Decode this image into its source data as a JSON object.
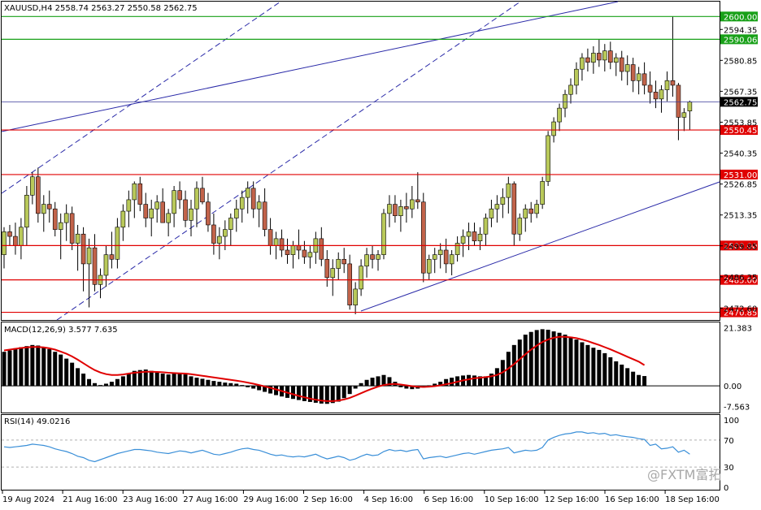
{
  "symbol_header": "XAUUSD,H4  2558.74 2563.27 2550.58 2562.75",
  "colors": {
    "bull_body": "#b9c95a",
    "bear_body": "#c2634a",
    "wick": "#000000",
    "support_line": "#e00000",
    "green_line": "#18a018",
    "channel_line": "#2a2aa8",
    "current_price_line": "#3a3a9a",
    "macd_hist": "#000000",
    "macd_signal": "#e00000",
    "rsi_line": "#3a8fd8",
    "rsi_level": "#b0b0b0",
    "tag_red": "#e00000",
    "tag_green": "#18a018",
    "tag_black": "#000000"
  },
  "price_axis": {
    "ticks": [
      "2594.35",
      "2580.85",
      "2567.35",
      "2553.85",
      "2540.35",
      "2526.85",
      "2513.35",
      "2499.85",
      "2486.35",
      "2472.60"
    ]
  },
  "horizontal_levels": [
    {
      "label": "2600.00",
      "value": 2600.0,
      "kind": "green"
    },
    {
      "label": "2590.06",
      "value": 2590.06,
      "kind": "green"
    },
    {
      "label": "2550.45",
      "value": 2550.45,
      "kind": "red"
    },
    {
      "label": "2531.00",
      "value": 2531.0,
      "kind": "red"
    },
    {
      "label": "2500.00",
      "value": 2500.0,
      "kind": "red"
    },
    {
      "label": "2485.00",
      "value": 2485.0,
      "kind": "red"
    },
    {
      "label": "2470.85",
      "value": 2470.85,
      "kind": "red"
    }
  ],
  "current_price": {
    "label": "2562.75",
    "value": 2562.75
  },
  "time_axis": {
    "labels": [
      "19 Aug 2024",
      "21 Aug 16:00",
      "23 Aug 16:00",
      "27 Aug 16:00",
      "29 Aug 16:00",
      "2 Sep 16:00",
      "4 Sep 16:00",
      "6 Sep 16:00",
      "10 Sep 16:00",
      "12 Sep 16:00",
      "16 Sep 16:00",
      "18 Sep 16:00"
    ]
  },
  "macd": {
    "header": "MACD(12,26,9) 3.577 7.635",
    "axis_ticks": [
      "21.383",
      "0.00",
      "-7.563"
    ]
  },
  "rsi": {
    "header": "RSI(14) 49.0216",
    "axis_ticks": [
      "100",
      "70",
      "30",
      "0"
    ],
    "levels": [
      70,
      30
    ]
  },
  "watermark": "@FXTM富拓",
  "chart_data": {
    "type": "candlestick",
    "series": [
      {
        "name": "XAUUSD,H4"
      }
    ],
    "ohlc_last": {
      "open": 2558.74,
      "high": 2563.27,
      "low": 2550.58,
      "close": 2562.75
    },
    "y_range": [
      2467.5,
      2606.5
    ],
    "candles": [
      [
        2496,
        2508,
        2490,
        2506
      ],
      [
        2506,
        2509,
        2500,
        2504
      ],
      [
        2504,
        2510,
        2496,
        2500
      ],
      [
        2500,
        2512,
        2494,
        2508
      ],
      [
        2508,
        2526,
        2500,
        2522
      ],
      [
        2522,
        2532,
        2518,
        2530
      ],
      [
        2530,
        2534,
        2510,
        2514
      ],
      [
        2514,
        2522,
        2506,
        2518
      ],
      [
        2518,
        2524,
        2510,
        2516
      ],
      [
        2516,
        2519,
        2504,
        2507
      ],
      [
        2507,
        2514,
        2494,
        2510
      ],
      [
        2510,
        2518,
        2502,
        2514
      ],
      [
        2514,
        2517,
        2498,
        2501
      ],
      [
        2501,
        2509,
        2489,
        2505
      ],
      [
        2505,
        2508,
        2480,
        2492
      ],
      [
        2492,
        2503,
        2473,
        2499
      ],
      [
        2499,
        2505,
        2480,
        2483
      ],
      [
        2483,
        2490,
        2477,
        2487
      ],
      [
        2487,
        2500,
        2482,
        2496
      ],
      [
        2496,
        2506,
        2490,
        2494
      ],
      [
        2494,
        2512,
        2490,
        2508
      ],
      [
        2508,
        2518,
        2502,
        2515
      ],
      [
        2515,
        2524,
        2508,
        2520
      ],
      [
        2520,
        2528,
        2512,
        2527
      ],
      [
        2527,
        2530,
        2515,
        2518
      ],
      [
        2518,
        2523,
        2508,
        2512
      ],
      [
        2512,
        2520,
        2504,
        2516
      ],
      [
        2516,
        2522,
        2510,
        2519
      ],
      [
        2519,
        2525,
        2512,
        2510
      ],
      [
        2510,
        2516,
        2504,
        2514
      ],
      [
        2514,
        2526,
        2508,
        2524
      ],
      [
        2524,
        2528,
        2516,
        2520
      ],
      [
        2520,
        2524,
        2508,
        2511
      ],
      [
        2511,
        2520,
        2504,
        2516
      ],
      [
        2516,
        2528,
        2508,
        2525
      ],
      [
        2525,
        2530,
        2518,
        2519
      ],
      [
        2519,
        2523,
        2506,
        2509
      ],
      [
        2509,
        2514,
        2496,
        2501
      ],
      [
        2501,
        2508,
        2494,
        2504
      ],
      [
        2504,
        2511,
        2498,
        2507
      ],
      [
        2507,
        2514,
        2500,
        2512
      ],
      [
        2512,
        2520,
        2506,
        2516
      ],
      [
        2516,
        2524,
        2510,
        2521
      ],
      [
        2521,
        2528,
        2514,
        2525
      ],
      [
        2525,
        2528,
        2512,
        2516
      ],
      [
        2516,
        2522,
        2508,
        2519
      ],
      [
        2519,
        2525,
        2504,
        2507
      ],
      [
        2507,
        2512,
        2496,
        2500
      ],
      [
        2500,
        2506,
        2494,
        2503
      ],
      [
        2503,
        2507,
        2495,
        2498
      ],
      [
        2498,
        2503,
        2492,
        2496
      ],
      [
        2496,
        2502,
        2490,
        2500
      ],
      [
        2500,
        2507,
        2494,
        2498
      ],
      [
        2498,
        2502,
        2492,
        2495
      ],
      [
        2495,
        2500,
        2490,
        2497
      ],
      [
        2497,
        2506,
        2492,
        2503
      ],
      [
        2503,
        2508,
        2491,
        2494
      ],
      [
        2494,
        2498,
        2482,
        2486
      ],
      [
        2486,
        2494,
        2478,
        2490
      ],
      [
        2490,
        2497,
        2485,
        2494
      ],
      [
        2494,
        2499,
        2488,
        2492
      ],
      [
        2492,
        2496,
        2472,
        2474
      ],
      [
        2474,
        2484,
        2470,
        2481
      ],
      [
        2481,
        2494,
        2478,
        2491
      ],
      [
        2491,
        2499,
        2486,
        2496
      ],
      [
        2496,
        2500,
        2490,
        2494
      ],
      [
        2494,
        2498,
        2489,
        2496
      ],
      [
        2496,
        2516,
        2494,
        2514
      ],
      [
        2514,
        2522,
        2508,
        2518
      ],
      [
        2518,
        2522,
        2510,
        2513
      ],
      [
        2513,
        2520,
        2506,
        2517
      ],
      [
        2517,
        2523,
        2510,
        2516
      ],
      [
        2516,
        2526,
        2512,
        2520
      ],
      [
        2520,
        2532,
        2516,
        2519
      ],
      [
        2519,
        2523,
        2484,
        2488
      ],
      [
        2488,
        2496,
        2485,
        2494
      ],
      [
        2494,
        2499,
        2488,
        2496
      ],
      [
        2496,
        2501,
        2490,
        2498
      ],
      [
        2498,
        2503,
        2488,
        2492
      ],
      [
        2492,
        2498,
        2487,
        2496
      ],
      [
        2496,
        2504,
        2493,
        2501
      ],
      [
        2501,
        2507,
        2495,
        2504
      ],
      [
        2504,
        2510,
        2498,
        2506
      ],
      [
        2506,
        2510,
        2500,
        2502
      ],
      [
        2502,
        2508,
        2498,
        2505
      ],
      [
        2505,
        2514,
        2500,
        2512
      ],
      [
        2512,
        2520,
        2508,
        2516
      ],
      [
        2516,
        2522,
        2510,
        2518
      ],
      [
        2518,
        2525,
        2512,
        2521
      ],
      [
        2521,
        2530,
        2514,
        2527
      ],
      [
        2527,
        2528,
        2500,
        2505
      ],
      [
        2505,
        2514,
        2502,
        2512
      ],
      [
        2512,
        2518,
        2506,
        2516
      ],
      [
        2516,
        2519,
        2510,
        2514
      ],
      [
        2514,
        2520,
        2512,
        2518
      ],
      [
        2518,
        2530,
        2516,
        2528
      ],
      [
        2528,
        2550,
        2526,
        2548
      ],
      [
        2548,
        2556,
        2545,
        2554
      ],
      [
        2554,
        2562,
        2550,
        2560
      ],
      [
        2560,
        2568,
        2556,
        2566
      ],
      [
        2566,
        2573,
        2562,
        2570
      ],
      [
        2570,
        2580,
        2566,
        2577
      ],
      [
        2577,
        2584,
        2572,
        2582
      ],
      [
        2582,
        2586,
        2576,
        2580
      ],
      [
        2580,
        2587,
        2575,
        2584
      ],
      [
        2584,
        2590,
        2578,
        2581
      ],
      [
        2581,
        2588,
        2576,
        2585
      ],
      [
        2585,
        2589,
        2577,
        2580
      ],
      [
        2580,
        2584,
        2574,
        2582
      ],
      [
        2582,
        2585,
        2572,
        2576
      ],
      [
        2576,
        2583,
        2570,
        2579
      ],
      [
        2579,
        2582,
        2567,
        2572
      ],
      [
        2572,
        2578,
        2566,
        2575
      ],
      [
        2575,
        2580,
        2566,
        2570
      ],
      [
        2570,
        2576,
        2562,
        2567
      ],
      [
        2567,
        2572,
        2560,
        2564
      ],
      [
        2564,
        2570,
        2558,
        2568
      ],
      [
        2568,
        2576,
        2563,
        2572
      ],
      [
        2572,
        2600,
        2565,
        2570
      ],
      [
        2570,
        2571,
        2546,
        2556
      ],
      [
        2556,
        2560,
        2550,
        2558
      ],
      [
        2558.74,
        2563.27,
        2550.58,
        2562.75
      ]
    ],
    "macd_histogram": [
      12.5,
      13.0,
      13.8,
      14.2,
      14.6,
      15.0,
      14.8,
      14.2,
      13.5,
      12.5,
      11.5,
      10.0,
      8.5,
      6.5,
      4.5,
      2.5,
      1.0,
      0.3,
      0.8,
      1.5,
      2.5,
      3.5,
      4.5,
      5.5,
      5.8,
      6.0,
      5.5,
      5.0,
      4.5,
      4.2,
      4.5,
      4.8,
      4.2,
      3.5,
      3.0,
      2.6,
      2.2,
      1.8,
      1.5,
      1.2,
      1.0,
      0.8,
      0.3,
      -0.5,
      -1.0,
      -1.6,
      -2.2,
      -2.8,
      -3.4,
      -3.9,
      -4.4,
      -4.8,
      -5.2,
      -5.6,
      -5.9,
      -6.2,
      -6.5,
      -6.6,
      -6.3,
      -5.8,
      -4.5,
      -3.0,
      -1.0,
      1.0,
      2.2,
      3.0,
      3.5,
      4.0,
      3.2,
      1.5,
      -0.5,
      -1.0,
      -1.2,
      -1.0,
      -0.6,
      0.2,
      0.8,
      1.5,
      2.5,
      3.0,
      3.5,
      3.8,
      4.0,
      3.8,
      3.5,
      3.5,
      4.5,
      6.5,
      9.5,
      12.5,
      15.0,
      17.0,
      18.8,
      19.8,
      20.5,
      20.8,
      20.6,
      20.0,
      19.5,
      18.8,
      18.0,
      17.0,
      16.0,
      15.0,
      14.0,
      13.2,
      12.0,
      10.5,
      9.0,
      7.8,
      6.5,
      5.2,
      4.0,
      3.6
    ],
    "macd_signal": [
      13.0,
      13.3,
      13.6,
      13.9,
      14.1,
      14.3,
      14.3,
      14.1,
      13.8,
      13.3,
      12.6,
      11.8,
      10.8,
      9.6,
      8.3,
      7.0,
      5.8,
      4.9,
      4.3,
      4.0,
      4.0,
      4.2,
      4.5,
      4.8,
      5.0,
      5.2,
      5.2,
      5.1,
      5.0,
      4.8,
      4.7,
      4.6,
      4.5,
      4.3,
      4.0,
      3.7,
      3.4,
      3.1,
      2.8,
      2.5,
      2.2,
      1.9,
      1.6,
      1.2,
      0.8,
      0.3,
      -0.2,
      -0.7,
      -1.3,
      -1.9,
      -2.5,
      -3.1,
      -3.7,
      -4.2,
      -4.7,
      -5.1,
      -5.4,
      -5.6,
      -5.6,
      -5.4,
      -5.0,
      -4.4,
      -3.6,
      -2.7,
      -1.8,
      -1.0,
      -0.3,
      0.3,
      0.6,
      0.7,
      0.5,
      0.2,
      -0.1,
      -0.3,
      -0.4,
      -0.3,
      -0.1,
      0.2,
      0.6,
      1.0,
      1.5,
      2.0,
      2.4,
      2.8,
      3.0,
      3.2,
      3.5,
      4.0,
      5.0,
      6.4,
      8.0,
      9.8,
      11.6,
      13.3,
      14.8,
      16.1,
      17.0,
      17.7,
      18.0,
      18.0,
      17.8,
      17.5,
      17.0,
      16.4,
      15.7,
      15.0,
      14.2,
      13.4,
      12.5,
      11.6,
      10.7,
      9.8,
      8.9,
      7.6
    ],
    "rsi_values": [
      60,
      59,
      60,
      61,
      62,
      64,
      63,
      62,
      60,
      57,
      55,
      53,
      50,
      46,
      44,
      40,
      38,
      41,
      44,
      47,
      50,
      52,
      54,
      56,
      56,
      55,
      54,
      52,
      51,
      50,
      52,
      54,
      53,
      51,
      53,
      55,
      52,
      49,
      48,
      50,
      52,
      55,
      57,
      58,
      56,
      55,
      52,
      49,
      47,
      48,
      46,
      45,
      46,
      45,
      47,
      49,
      45,
      42,
      44,
      46,
      44,
      40,
      42,
      46,
      49,
      47,
      48,
      53,
      56,
      54,
      55,
      53,
      55,
      56,
      42,
      44,
      45,
      46,
      44,
      46,
      48,
      50,
      51,
      49,
      51,
      53,
      55,
      56,
      57,
      59,
      51,
      53,
      55,
      54,
      55,
      59,
      70,
      74,
      77,
      79,
      80,
      82,
      82,
      80,
      81,
      79,
      80,
      77,
      78,
      76,
      75,
      74,
      72,
      71,
      62,
      64,
      57,
      58,
      60,
      52,
      55,
      49
    ],
    "annotations": [
      "horizontal support/resistance levels",
      "ascending trend channel",
      "parallel channel lines"
    ]
  }
}
